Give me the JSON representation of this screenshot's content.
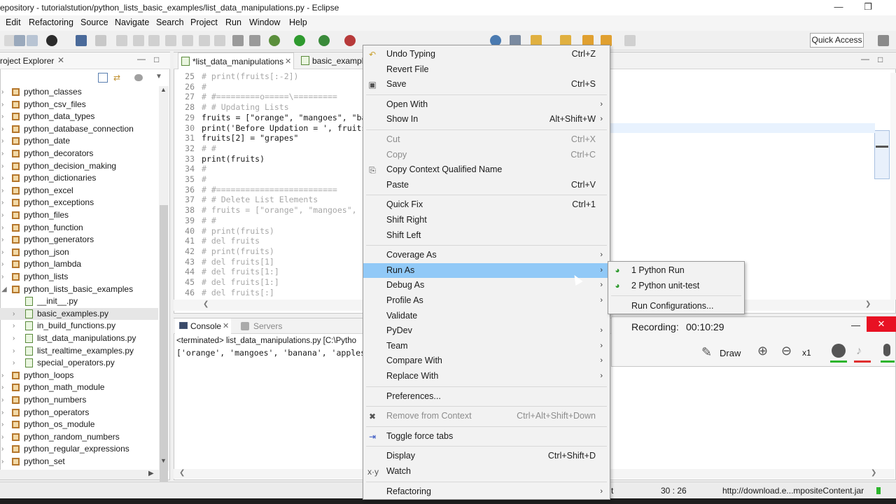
{
  "window": {
    "title": "epository - tutorialstution/python_lists_basic_examples/list_data_manipulations.py - Eclipse",
    "minimize_icon": "minimize-icon",
    "restore_icon": "restore-icon"
  },
  "menubar": [
    "Edit",
    "Refactoring",
    "Source",
    "Navigate",
    "Search",
    "Project",
    "Run",
    "Window",
    "Help"
  ],
  "toolbar": {
    "quick_access": "Quick Access"
  },
  "explorer": {
    "title": "roject Explorer",
    "items": [
      {
        "label": "python_classes",
        "type": "pkg",
        "expanded": false
      },
      {
        "label": "python_csv_files",
        "type": "pkg",
        "expanded": false
      },
      {
        "label": "python_data_types",
        "type": "pkg",
        "expanded": false
      },
      {
        "label": "python_database_connection",
        "type": "pkg",
        "expanded": false
      },
      {
        "label": "python_date",
        "type": "pkg",
        "expanded": false
      },
      {
        "label": "python_decorators",
        "type": "pkg",
        "expanded": false
      },
      {
        "label": "python_decision_making",
        "type": "pkg",
        "expanded": false
      },
      {
        "label": "python_dictionaries",
        "type": "pkg",
        "expanded": false
      },
      {
        "label": "python_excel",
        "type": "pkg",
        "expanded": false
      },
      {
        "label": "python_exceptions",
        "type": "pkg",
        "expanded": false
      },
      {
        "label": "python_files",
        "type": "pkg",
        "expanded": false
      },
      {
        "label": "python_function",
        "type": "pkg",
        "expanded": false
      },
      {
        "label": "python_generators",
        "type": "pkg",
        "expanded": false
      },
      {
        "label": "python_json",
        "type": "pkg",
        "expanded": false
      },
      {
        "label": "python_lambda",
        "type": "pkg",
        "expanded": false
      },
      {
        "label": "python_lists",
        "type": "pkg",
        "expanded": false
      },
      {
        "label": "python_lists_basic_examples",
        "type": "pkg",
        "expanded": true
      },
      {
        "label": "__init__.py",
        "type": "file",
        "expanded": false
      },
      {
        "label": "basic_examples.py",
        "type": "file",
        "expanded": false,
        "selected": true
      },
      {
        "label": "in_build_functions.py",
        "type": "file",
        "expanded": false
      },
      {
        "label": "list_data_manipulations.py",
        "type": "file",
        "expanded": false
      },
      {
        "label": "list_realtime_examples.py",
        "type": "file",
        "expanded": false
      },
      {
        "label": "special_operators.py",
        "type": "file",
        "expanded": false
      },
      {
        "label": "python_loops",
        "type": "pkg",
        "expanded": false
      },
      {
        "label": "python_math_module",
        "type": "pkg",
        "expanded": false
      },
      {
        "label": "python_numbers",
        "type": "pkg",
        "expanded": false
      },
      {
        "label": "python_operators",
        "type": "pkg",
        "expanded": false
      },
      {
        "label": "python_os_module",
        "type": "pkg",
        "expanded": false
      },
      {
        "label": "python_random_numbers",
        "type": "pkg",
        "expanded": false
      },
      {
        "label": "python_regular_expressions",
        "type": "pkg",
        "expanded": false
      },
      {
        "label": "python_set",
        "type": "pkg",
        "expanded": false
      }
    ]
  },
  "editor": {
    "tabs": [
      "*list_data_manipulations",
      "basic_exampl"
    ],
    "lines": [
      {
        "n": "25",
        "t": "# print(fruits[:-2])",
        "c": "comment"
      },
      {
        "n": "26",
        "t": "#",
        "c": "comment"
      },
      {
        "n": "27",
        "t": "# #=========o=====\\=========",
        "c": "comment"
      },
      {
        "n": "28",
        "t": "# # Updating Lists",
        "c": "comment"
      },
      {
        "n": "29",
        "t": "fruits = [\"orange\", \"mangoes\", \"ba",
        "c": "code"
      },
      {
        "n": "30",
        "t": "print('Before Updation = ', fruits",
        "c": "code"
      },
      {
        "n": "31",
        "t": "fruits[2] = \"grapes\"",
        "c": "code"
      },
      {
        "n": "32",
        "t": "# #",
        "c": "comment"
      },
      {
        "n": "33",
        "t": "print(fruits)",
        "c": "code"
      },
      {
        "n": "34",
        "t": "#",
        "c": "comment"
      },
      {
        "n": "35",
        "t": "#",
        "c": "comment"
      },
      {
        "n": "36",
        "t": "# #=========================",
        "c": "comment"
      },
      {
        "n": "37",
        "t": "# # Delete List Elements",
        "c": "comment"
      },
      {
        "n": "38",
        "t": "# fruits = [\"orange\", \"mangoes\",",
        "c": "comment"
      },
      {
        "n": "39",
        "t": "# #",
        "c": "comment"
      },
      {
        "n": "40",
        "t": "# print(fruits)",
        "c": "comment"
      },
      {
        "n": "41",
        "t": "# del fruits",
        "c": "comment"
      },
      {
        "n": "42",
        "t": "# print(fruits)",
        "c": "comment"
      },
      {
        "n": "43",
        "t": "# del fruits[1]",
        "c": "comment"
      },
      {
        "n": "44",
        "t": "# del fruits[1:]",
        "c": "comment"
      },
      {
        "n": "45",
        "t": "# del fruits[1:]",
        "c": "comment"
      },
      {
        "n": "46",
        "t": "# del fruits[:]",
        "c": "comment"
      }
    ]
  },
  "console": {
    "tabs": [
      "Console",
      "Servers"
    ],
    "terminated": "<terminated> list_data_manipulations.py [C:\\Pytho",
    "output": "['orange', 'mangoes', 'banana', 'apples"
  },
  "statusbar": {
    "position": "30 : 26",
    "url": "http://download.e...mpositeContent.jar",
    "t": "t"
  },
  "context_menu": {
    "items": [
      {
        "label": "Undo Typing",
        "shortcut": "Ctrl+Z",
        "icon": "undo-icon"
      },
      {
        "label": "Revert File"
      },
      {
        "label": "Save",
        "shortcut": "Ctrl+S",
        "icon": "save-icon"
      },
      {
        "sep": true
      },
      {
        "label": "Open With",
        "submenu": true
      },
      {
        "label": "Show In",
        "shortcut": "Alt+Shift+W",
        "submenu": true
      },
      {
        "sep": true
      },
      {
        "label": "Cut",
        "shortcut": "Ctrl+X",
        "disabled": true
      },
      {
        "label": "Copy",
        "shortcut": "Ctrl+C",
        "disabled": true
      },
      {
        "label": "Copy Context Qualified Name",
        "icon": "copy-qualified-icon"
      },
      {
        "label": "Paste",
        "shortcut": "Ctrl+V"
      },
      {
        "sep": true
      },
      {
        "label": "Quick Fix",
        "shortcut": "Ctrl+1"
      },
      {
        "label": "Shift Right"
      },
      {
        "label": "Shift Left"
      },
      {
        "sep": true
      },
      {
        "label": "Coverage As",
        "submenu": true
      },
      {
        "label": "Run As",
        "submenu": true,
        "highlighted": true
      },
      {
        "label": "Debug As",
        "submenu": true
      },
      {
        "label": "Profile As",
        "submenu": true
      },
      {
        "label": "Validate"
      },
      {
        "label": "PyDev",
        "submenu": true
      },
      {
        "label": "Team",
        "submenu": true
      },
      {
        "label": "Compare With",
        "submenu": true
      },
      {
        "label": "Replace With",
        "submenu": true
      },
      {
        "sep": true
      },
      {
        "label": "Preferences..."
      },
      {
        "sep": true
      },
      {
        "label": "Remove from Context",
        "shortcut": "Ctrl+Alt+Shift+Down",
        "disabled": true,
        "icon": "remove-context-icon"
      },
      {
        "sep": true
      },
      {
        "label": "Toggle force tabs",
        "icon": "tab-toggle-icon"
      },
      {
        "sep": true
      },
      {
        "label": "Display",
        "shortcut": "Ctrl+Shift+D"
      },
      {
        "label": "Watch",
        "icon": "watch-icon"
      },
      {
        "sep": true
      },
      {
        "label": "Refactoring",
        "submenu": true
      }
    ]
  },
  "submenu": {
    "items": [
      {
        "label": "1 Python Run",
        "icon": "python-run-icon"
      },
      {
        "label": "2 Python unit-test",
        "icon": "python-unittest-icon"
      },
      {
        "sep": true
      },
      {
        "label": "Run Configurations..."
      }
    ]
  },
  "recorder": {
    "label": "Recording:",
    "time": "00:10:29",
    "draw": "Draw",
    "zoom": "x1"
  }
}
